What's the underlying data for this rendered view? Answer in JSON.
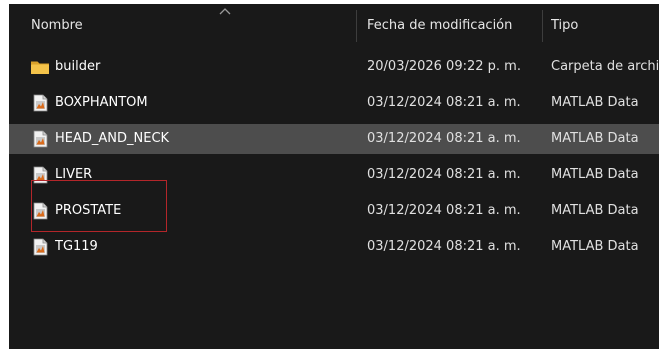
{
  "columns": {
    "name": "Nombre",
    "date": "Fecha de modificación",
    "type": "Tipo"
  },
  "files": [
    {
      "name": "builder",
      "date": "20/03/2026 09:22 p. m.",
      "type": "Carpeta de archivos",
      "icon": "folder-icon",
      "selected": false
    },
    {
      "name": "BOXPHANTOM",
      "date": "03/12/2024 08:21 a. m.",
      "type": "MATLAB Data",
      "icon": "matlab-data-file-icon",
      "selected": false
    },
    {
      "name": "HEAD_AND_NECK",
      "date": "03/12/2024 08:21 a. m.",
      "type": "MATLAB Data",
      "icon": "matlab-data-file-icon",
      "selected": true
    },
    {
      "name": "LIVER",
      "date": "03/12/2024 08:21 a. m.",
      "type": "MATLAB Data",
      "icon": "matlab-data-file-icon",
      "selected": false
    },
    {
      "name": "PROSTATE",
      "date": "03/12/2024 08:21 a. m.",
      "type": "MATLAB Data",
      "icon": "matlab-data-file-icon",
      "selected": false
    },
    {
      "name": "TG119",
      "date": "03/12/2024 08:21 a. m.",
      "type": "MATLAB Data",
      "icon": "matlab-data-file-icon",
      "selected": false
    }
  ],
  "colors": {
    "background": "#191919",
    "selected_row": "#4d4d4d",
    "folder": "#f4c34a",
    "annotation": "#b3262a"
  }
}
